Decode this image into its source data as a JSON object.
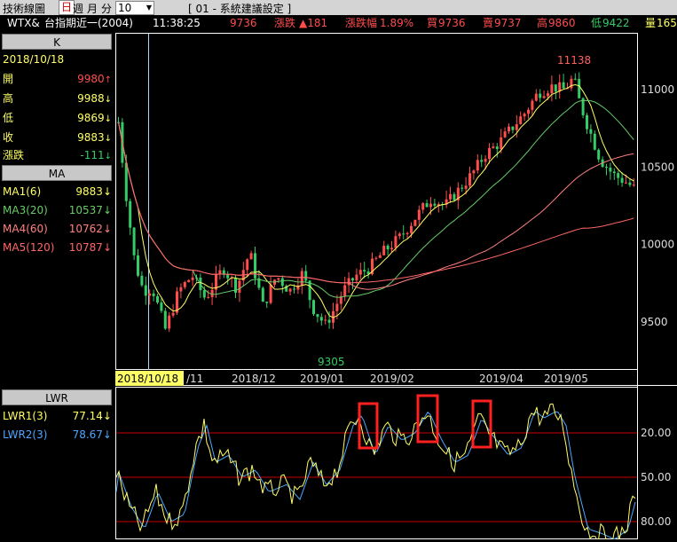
{
  "menu": {
    "app_title": "技術線圖",
    "period_day": "日",
    "period_week": "週",
    "period_month": "月",
    "period_minute": "分",
    "minute_value": "10",
    "template": "[ 01 - 系統建議設定 ]"
  },
  "quote": {
    "symbol": "WTX&",
    "name": "台指期近一(2004)",
    "time": "11:38:25",
    "price": "9736",
    "change_label": "漲跌",
    "change": "▲181",
    "pct_label": "漲跌幅",
    "pct": "1.89%",
    "bid_label": "買",
    "bid": "9736",
    "ask_label": "賣",
    "ask": "9737",
    "high_label": "高",
    "high": "9860",
    "low_label": "低",
    "low": "9422",
    "vol_label": "量",
    "vol": "165"
  },
  "k_panel": {
    "title": "K",
    "date": "2018/10/18",
    "open_label": "開",
    "open": "9980",
    "high_label": "高",
    "high": "9988",
    "low_label": "低",
    "low": "9869",
    "close_label": "收",
    "close": "9883",
    "chg_label": "漲跌",
    "chg": "-111"
  },
  "ma_panel": {
    "title": "MA",
    "items": [
      {
        "label": "MA1(6)",
        "value": "9883",
        "color": "#ffff66"
      },
      {
        "label": "MA3(20)",
        "value": "10537",
        "color": "#66cc66"
      },
      {
        "label": "MA4(60)",
        "value": "10762",
        "color": "#ff8080"
      },
      {
        "label": "MA5(120)",
        "value": "10787",
        "color": "#ff6666"
      }
    ]
  },
  "lwr_panel": {
    "title": "LWR",
    "items": [
      {
        "label": "LWR1(3)",
        "value": "77.14",
        "color": "#ffff66"
      },
      {
        "label": "LWR2(3)",
        "value": "78.67",
        "color": "#4da6ff"
      }
    ]
  },
  "price_axis": {
    "ticks": [
      "11000",
      "10500",
      "10000",
      "9500"
    ]
  },
  "time_axis": {
    "cursor_label": "2018/10/18",
    "labels": [
      "/11",
      "2018/12",
      "2019/01",
      "2019/02",
      "2019/04",
      "2019/05"
    ]
  },
  "annotations": {
    "peak": "11138",
    "trough": "9305"
  },
  "lwr_axis": {
    "ticks": [
      "20.00",
      "50.00",
      "80.00"
    ]
  },
  "colors": {
    "up": "#ff4d4d",
    "down": "#33cc66",
    "ma1": "#ffff66",
    "ma3": "#66cc66",
    "ma4": "#ff8080",
    "ma5": "#ff6666",
    "lwr2": "#4da6ff",
    "highlight_box": "#ff2020"
  }
}
